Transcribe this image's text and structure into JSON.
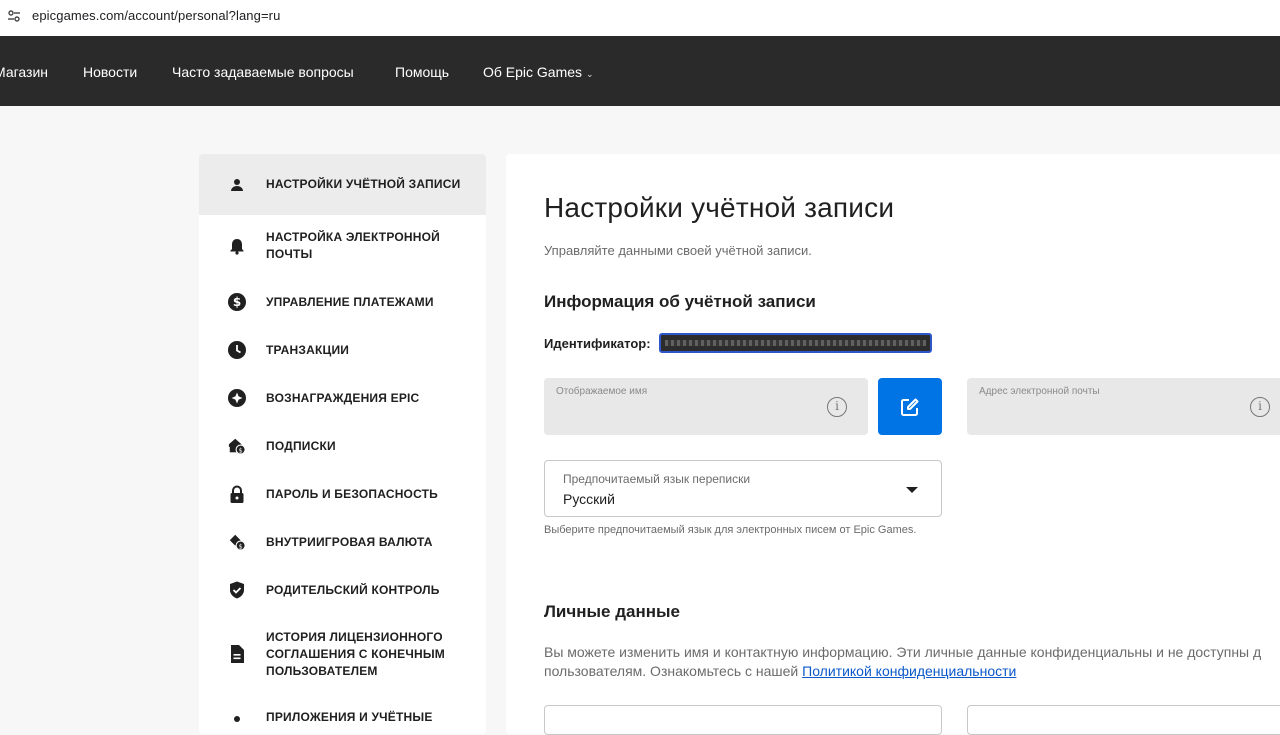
{
  "browser": {
    "url": "epicgames.com/account/personal?lang=ru"
  },
  "nav": {
    "items": [
      {
        "label": "Магазин"
      },
      {
        "label": "Новости"
      },
      {
        "label": "Часто задаваемые вопросы"
      },
      {
        "label": "Помощь"
      },
      {
        "label": "Об Epic Games"
      }
    ]
  },
  "sidebar": {
    "items": [
      {
        "label": "Настройки учётной записи",
        "icon": "person-icon",
        "active": true
      },
      {
        "label": "Настройка электронной почты",
        "icon": "bell-icon"
      },
      {
        "label": "Управление платежами",
        "icon": "dollar-icon"
      },
      {
        "label": "Транзакции",
        "icon": "clock-icon"
      },
      {
        "label": "Вознаграждения Epic",
        "icon": "star-icon"
      },
      {
        "label": "Подписки",
        "icon": "subscription-icon"
      },
      {
        "label": "Пароль и безопасность",
        "icon": "lock-icon"
      },
      {
        "label": "Внутриигровая валюта",
        "icon": "currency-icon"
      },
      {
        "label": "Родительский контроль",
        "icon": "shield-icon"
      },
      {
        "label": "История лицензионного соглашения с конечным пользователем",
        "icon": "document-icon"
      },
      {
        "label": "Приложения и учётные",
        "icon": "apps-icon"
      }
    ]
  },
  "main": {
    "title": "Настройки учётной записи",
    "subtitle": "Управляйте данными своей учётной записи.",
    "account_info": {
      "heading": "Информация об учётной записи",
      "id_label": "Идентификатор:",
      "display_name_label": "Отображаемое имя",
      "email_label": "Адрес электронной почты",
      "info_glyph": "i"
    },
    "language": {
      "label": "Предпочитаемый язык переписки",
      "value": "Русский",
      "hint": "Выберите предпочитаемый язык для электронных писем от Epic Games."
    },
    "personal": {
      "heading": "Личные данные",
      "text_line1": "Вы можете изменить имя и контактную информацию. Эти личные данные конфиденциальны и не доступны д",
      "text_line2": "пользователям. Ознакомьтесь с нашей ",
      "privacy_link": "Политикой конфиденциальности"
    }
  },
  "colors": {
    "accent": "#0074e4",
    "nav_bg": "#2a2a2a",
    "link": "#0a58ca"
  }
}
